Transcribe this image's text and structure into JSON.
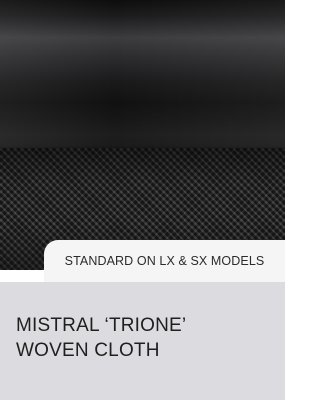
{
  "badge": {
    "label": "STANDARD ON LX & SX MODELS"
  },
  "title": {
    "line1": "MISTRAL ‘TRIONE’",
    "line2": "WOVEN CLOTH"
  },
  "colors": {
    "badge_bg": "#f5f5f5",
    "panel_bg": "#dcdce0",
    "text": "#1f1f1f"
  },
  "image": {
    "subject": "woven-cloth-material-photo"
  }
}
